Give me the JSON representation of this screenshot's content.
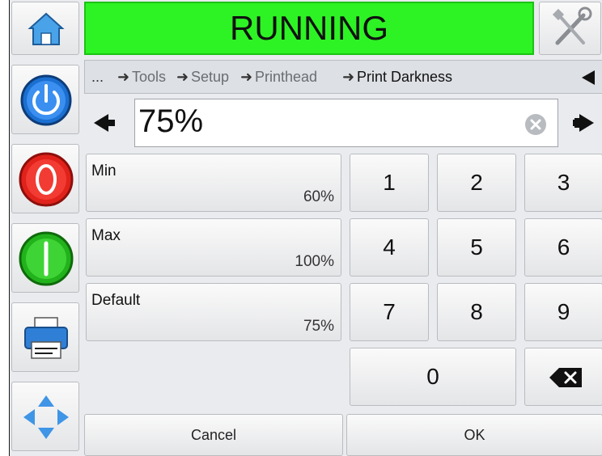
{
  "status": {
    "text": "RUNNING",
    "color": "#2df324"
  },
  "icons": {
    "home": "home-icon",
    "tools": "tools-icon",
    "power": "power-icon",
    "stop": "stop-icon",
    "start": "start-icon",
    "printer": "printer-icon",
    "navigate": "navigate-icon"
  },
  "breadcrumb": {
    "ellipsis": "...",
    "items": [
      "Tools",
      "Setup",
      "Printhead",
      "Print Darkness"
    ],
    "separator": "➜"
  },
  "input": {
    "value": "75%"
  },
  "presets": [
    {
      "label": "Min",
      "value": "60%"
    },
    {
      "label": "Max",
      "value": "100%"
    },
    {
      "label": "Default",
      "value": "75%"
    }
  ],
  "keypad": [
    "1",
    "2",
    "3",
    "4",
    "5",
    "6",
    "7",
    "8",
    "9",
    "0"
  ],
  "footer": {
    "cancel": "Cancel",
    "ok": "OK"
  }
}
